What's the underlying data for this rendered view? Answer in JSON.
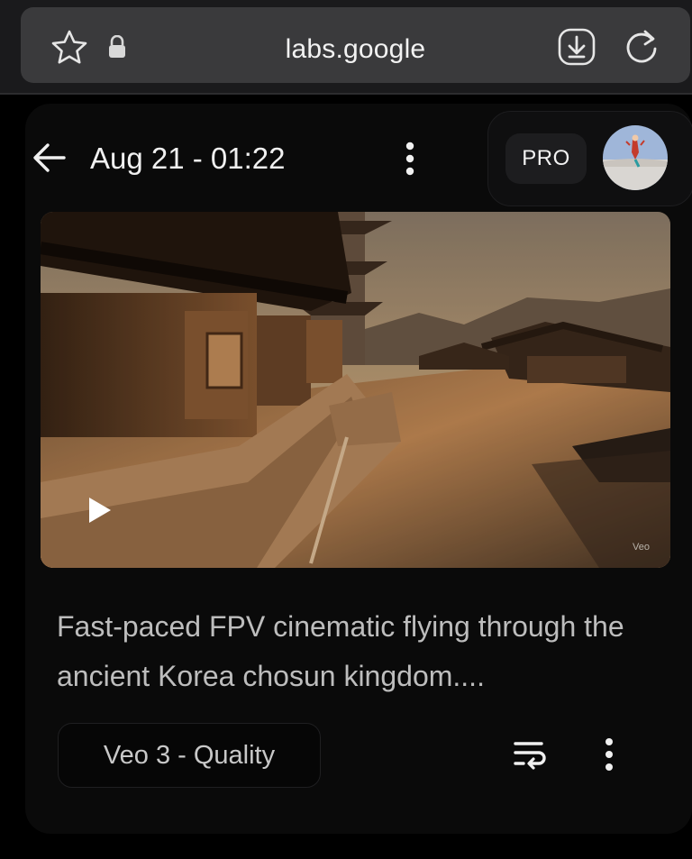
{
  "browser": {
    "url": "labs.google",
    "icons": [
      "star-icon",
      "lock-icon",
      "download-icon",
      "reload-icon"
    ]
  },
  "header": {
    "title": "Aug 21 - 01:22",
    "badge": "PRO",
    "icons": [
      "back-arrow-icon",
      "more-vert-icon",
      "avatar"
    ]
  },
  "video": {
    "watermark": "Veo",
    "description": "Pagoda courtyard with traditional Korean temple buildings at sunset",
    "icons": [
      "play-icon"
    ]
  },
  "prompt": {
    "text": "Fast-paced FPV cinematic flying through the ancient Korea chosun kingdom...."
  },
  "footer": {
    "model_label": "Veo 3 - Quality",
    "icons": [
      "reuse-prompt-icon",
      "more-vert-icon"
    ]
  },
  "colors": {
    "background": "#000000",
    "browser_bar": "#1a1a1c",
    "url_pill": "#3a3a3c",
    "prompt_text": "#bdbdbd"
  }
}
